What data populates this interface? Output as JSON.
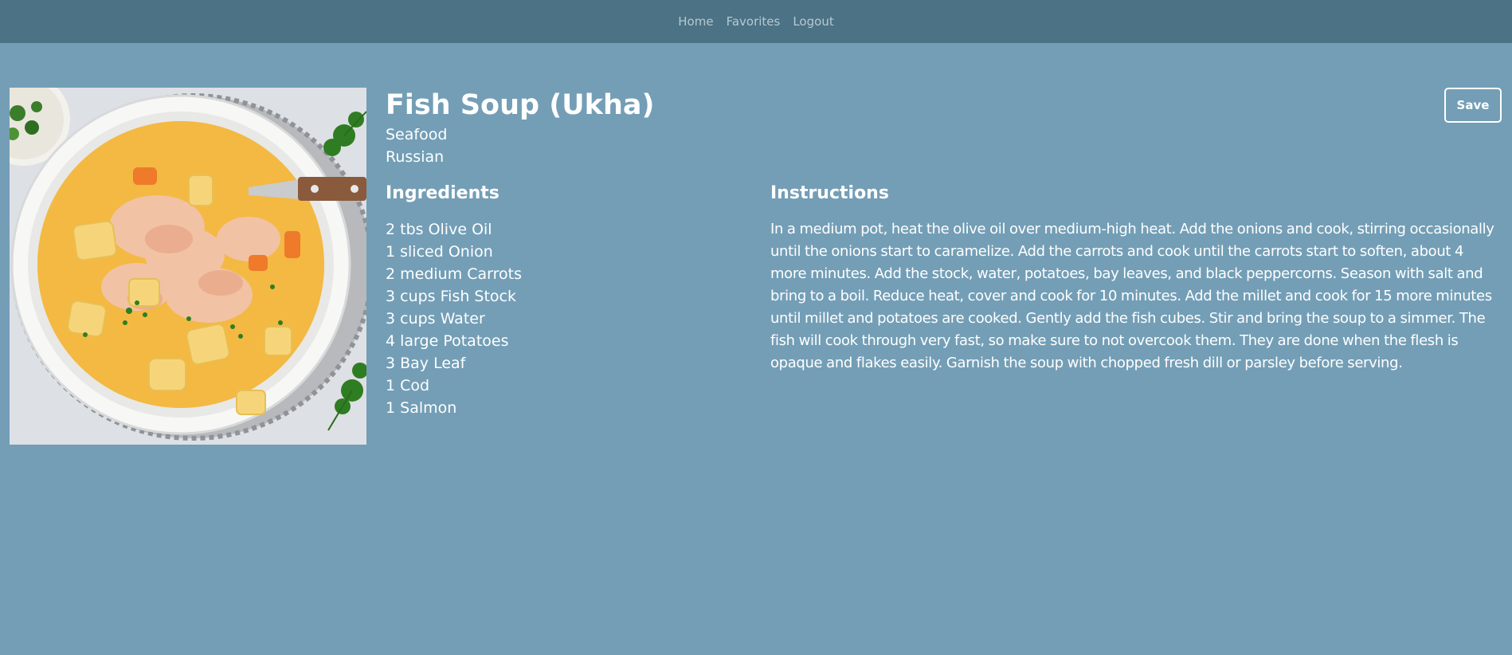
{
  "nav": {
    "links": [
      "Home",
      "Favorites",
      "Logout"
    ]
  },
  "recipe": {
    "title": "Fish Soup (Ukha)",
    "category": "Seafood",
    "cuisine": "Russian",
    "save_label": "Save",
    "image_icon": "fish-soup-bowl-image",
    "ingredients_heading": "Ingredients",
    "ingredients": [
      "2 tbs Olive Oil",
      "1 sliced Onion",
      "2 medium Carrots",
      "3 cups Fish Stock",
      "3 cups Water",
      "4 large Potatoes",
      "3 Bay Leaf",
      "1 Cod",
      "1 Salmon"
    ],
    "instructions_heading": "Instructions",
    "instructions": "In a medium pot, heat the olive oil over medium-high heat. Add the onions and cook, stirring occasionally until the onions start to caramelize. Add the carrots and cook until the carrots start to soften, about 4 more minutes. Add the stock, water, potatoes, bay leaves, and black peppercorns. Season with salt and bring to a boil. Reduce heat, cover and cook for 10 minutes. Add the millet and cook for 15 more minutes until millet and potatoes are cooked. Gently add the fish cubes. Stir and bring the soup to a simmer. The fish will cook through very fast, so make sure to not overcook them. They are done when the flesh is opaque and flakes easily. Garnish the soup with chopped fresh dill or parsley before serving."
  },
  "colors": {
    "page_background": "#739eb6",
    "navbar_background": "#4b7285",
    "nav_link": "#b9c8d0",
    "text": "#ffffff"
  }
}
